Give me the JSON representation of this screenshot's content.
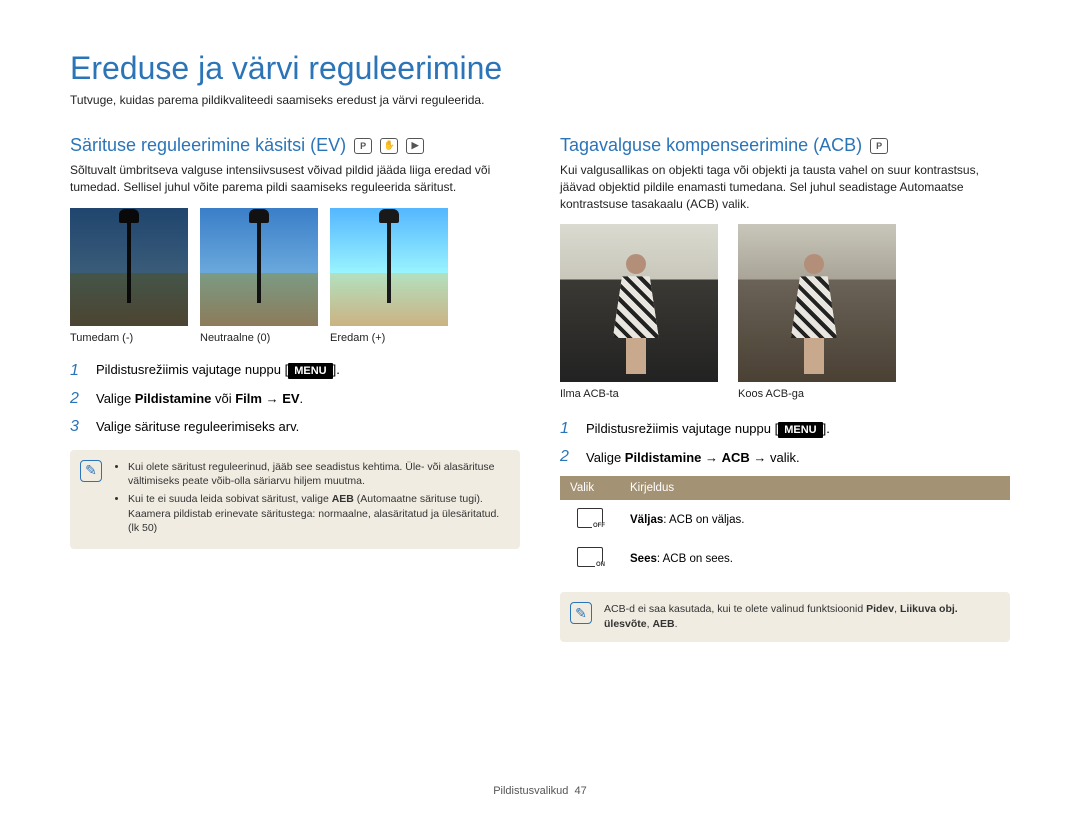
{
  "title": "Ereduse ja värvi reguleerimine",
  "subtitle": "Tutvuge, kuidas parema pildikvaliteedi saamiseks eredust ja värvi reguleerida.",
  "left": {
    "heading": "Särituse reguleerimine käsitsi (EV)",
    "desc": "Sõltuvalt ümbritseva valguse intensiivsusest võivad pildid jääda liiga eredad või tumedad. Sellisel juhul võite parema pildi saamiseks reguleerida säritust.",
    "captions": [
      "Tumedam (-)",
      "Neutraalne (0)",
      "Eredam (+)"
    ],
    "steps": [
      {
        "num": "1",
        "pre": "Pildistusrežiimis vajutage nuppu [",
        "badge": "MENU",
        "post": "]."
      },
      {
        "num": "2",
        "html": "Valige <b>Pildistamine</b> või <b>Film</b> → <b>EV</b>."
      },
      {
        "num": "3",
        "html": "Valige särituse reguleerimiseks arv."
      }
    ],
    "note": {
      "items": [
        "Kui olete säritust reguleerinud, jääb see seadistus kehtima. Üle- või alasärituse vältimiseks peate võib-olla säriarvu hiljem muutma.",
        "Kui te ei suuda leida sobivat säritust, valige <b>AEB</b> (Automaatne särituse tugi). Kaamera pildistab erinevate säritustega: normaalne, alasäritatud ja ülesäritatud. (lk 50)"
      ]
    }
  },
  "right": {
    "heading": "Tagavalguse kompenseerimine (ACB)",
    "desc": "Kui valgusallikas on objekti taga või objekti ja tausta vahel on suur kontrastsus, jäävad objektid pildile enamasti tumedana. Sel juhul seadistage Automaatse kontrastsuse tasakaalu (ACB) valik.",
    "captions": [
      "Ilma ACB-ta",
      "Koos ACB-ga"
    ],
    "steps": [
      {
        "num": "1",
        "pre": "Pildistusrežiimis vajutage nuppu [",
        "badge": "MENU",
        "post": "]."
      },
      {
        "num": "2",
        "html": "Valige <b>Pildistamine</b> → <b>ACB</b> → valik."
      }
    ],
    "table": {
      "headers": [
        "Valik",
        "Kirjeldus"
      ],
      "rows": [
        {
          "iconSub": "OFF",
          "label": "Väljas",
          "text": ": ACB on väljas."
        },
        {
          "iconSub": "ON",
          "label": "Sees",
          "text": ": ACB on sees."
        }
      ]
    },
    "note2": "ACB-d ei saa kasutada, kui te olete valinud funktsioonid <b>Pidev</b>, <b>Liikuva obj. ülesvõte</b>, <b>AEB</b>."
  },
  "footer": {
    "section": "Pildistusvalikud",
    "page": "47"
  }
}
